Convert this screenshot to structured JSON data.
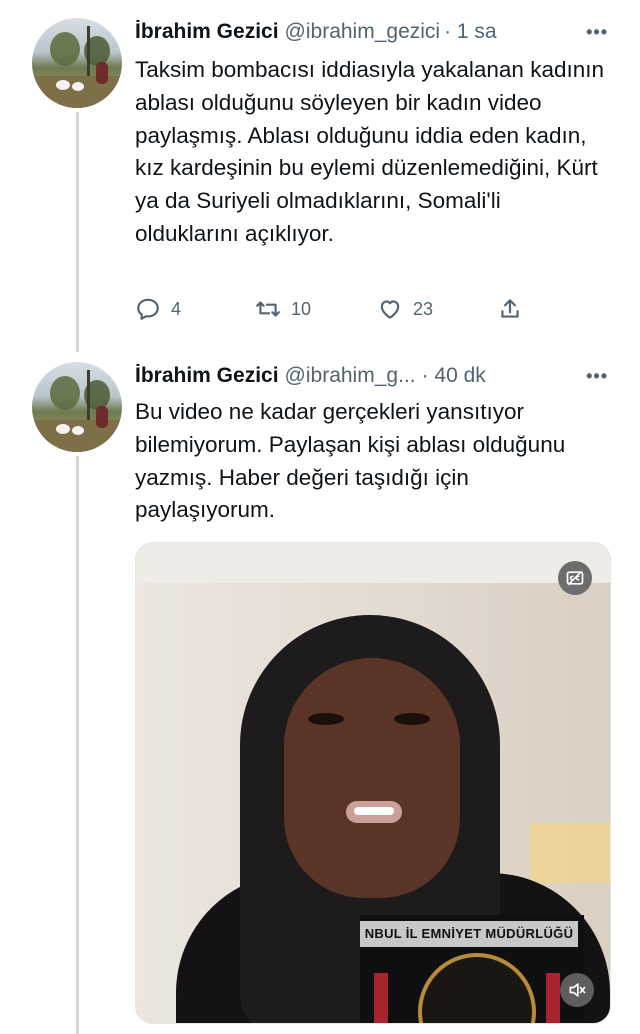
{
  "tweets": [
    {
      "name": "İbrahim Gezici",
      "handle": "@ibrahim_gezici",
      "time": "· 1 sa",
      "text": "Taksim bombacısı iddiasıyla yakalanan kadının ablası olduğunu söyleyen bir kadın video paylaşmış. Ablası olduğunu iddia eden kadın, kız kardeşinin bu eylemi düzenlemediğini, Kürt ya da Suriyeli olmadıklarını, Somali'li olduklarını açıklıyor.",
      "replies": "4",
      "retweets": "10",
      "likes": "23"
    },
    {
      "name": "İbrahim Gezici",
      "handle": "@ibrahim_g...",
      "time": "· 40 dk",
      "text": "Bu video ne kadar gerçekleri yansıtıyor bilemiyorum. Paylaşan kişi ablası olduğunu yazmış. Haber değeri taşıdığı için paylaşıyorum.",
      "media": {
        "overlay_text": "NBUL İL EMNİYET MÜDÜRLÜĞÜ",
        "captions_icon": "closed-captions-icon",
        "mute_icon": "muted-speaker-icon"
      }
    }
  ],
  "more_icon": "more-dots-icon",
  "colors": {
    "text": "#0f1419",
    "secondary": "#536471",
    "thread_line": "#cfd9de"
  }
}
